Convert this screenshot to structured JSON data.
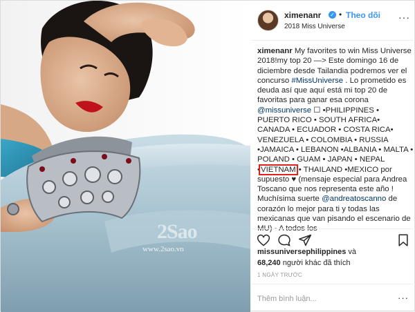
{
  "header": {
    "username": "ximenanr",
    "verified_glyph": "✓",
    "separator": "•",
    "follow_label": "Theo dõi",
    "location": "2018 Miss Universe",
    "more_glyph": "···"
  },
  "photo": {
    "watermark_logo": "2Sao",
    "watermark_url": "www.2sao.vn"
  },
  "caption": {
    "username": "ximenanr",
    "text_1": " My favorites to win Miss Universe 2018!my top 20 —> Este domingo 16 de diciembre desde Tailandia podremos ver el concurso ",
    "hashtag": "#MissUniverse",
    "text_2": " . Lo prometido es deuda así que aquí está mi top 20 de favoritas para ganar esa corona ",
    "mention_1": "@missuniverse",
    "text_3": " ☐ •PHILIPPINES • PUERTO RICO • SOUTH AFRICA• CANADA • ECUADOR • COSTA RICA• VENEZUELA • COLOMBIA • RUSSIA •JAMAICA • LEBANON •ALBANIA • MALTA • POLAND • GUAM • JAPAN • NEPAL •",
    "highlighted": "VIETNAM",
    "text_4": " • THAILAND •MEXICO por supuesto ♥ (mensaje especial para Andrea Toscano que nos representa este año ! Muchísima suerte ",
    "mention_2": "@andreatoscanno",
    "text_5": " de corazón lo mejor para ti y todas las mexicanas que van pisando el escenario de MU) - A todos los"
  },
  "actions": {
    "icons": [
      "heart-icon",
      "comment-icon",
      "share-icon",
      "bookmark-icon"
    ]
  },
  "likes": {
    "liker": "missuniversephilippines",
    "and": " và",
    "count": "68,240",
    "others": " người khác đã thích"
  },
  "timestamp": "1 NGÀY TRƯỚC",
  "comment": {
    "placeholder": "Thêm bình luận...",
    "more_glyph": "···"
  },
  "colors": {
    "link": "#003569",
    "follow": "#3897f0",
    "highlight_box": "#e0201b"
  }
}
